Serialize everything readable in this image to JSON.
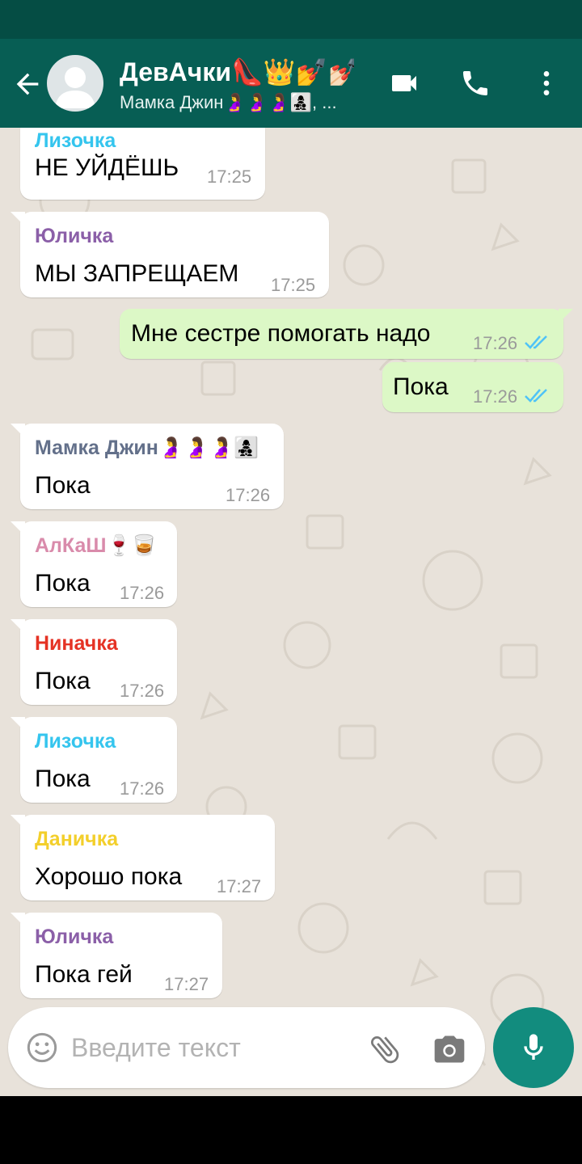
{
  "header": {
    "title": "ДевАчки👠👑💅💅🏻",
    "subtitle": "Мамка Джин🤰🤰🤰👩‍👧‍👦, ..."
  },
  "colors": {
    "header": "#075e54",
    "chat_bg": "#e8e2da",
    "outgoing": "#dcf8c6",
    "accent": "#128c7e",
    "read_ticks": "#4fc3f7"
  },
  "messages": [
    {
      "sender": "Лизочка",
      "sender_color": "#35c5ee",
      "text": "НЕ УЙДЁШЬ",
      "time": "17:25",
      "dir": "in"
    },
    {
      "sender": "Юличка",
      "sender_color": "#8b5fa8",
      "text": "МЫ ЗАПРЕЩАЕМ",
      "time": "17:25",
      "dir": "in"
    },
    {
      "text": "Мне сестре помогать надо",
      "time": "17:26",
      "dir": "out"
    },
    {
      "text": "Пока",
      "time": "17:26",
      "dir": "out"
    },
    {
      "sender": "Мамка Джин🤰🤰🤰👩‍👧‍👦",
      "sender_color": "#63708a",
      "text": "Пока",
      "time": "17:26",
      "dir": "in"
    },
    {
      "sender": "АлКаШ🍷🥃",
      "sender_color": "#d98bab",
      "text": "Пока",
      "time": "17:26",
      "dir": "in"
    },
    {
      "sender": "Ниначка",
      "sender_color": "#e53224",
      "text": "Пока",
      "time": "17:26",
      "dir": "in"
    },
    {
      "sender": "Лизочка",
      "sender_color": "#35c5ee",
      "text": "Пока",
      "time": "17:26",
      "dir": "in"
    },
    {
      "sender": "Даничка",
      "sender_color": "#f3cf2b",
      "text": "Хорошо пока",
      "time": "17:27",
      "dir": "in"
    },
    {
      "sender": "Юличка",
      "sender_color": "#8b5fa8",
      "text": "Пока гей",
      "time": "17:27",
      "dir": "in"
    }
  ],
  "input": {
    "placeholder": "Введите текст"
  },
  "icons": {
    "back": "arrow-left",
    "video": "video-camera",
    "call": "phone",
    "menu": "more-vert",
    "emoji": "smiley",
    "attach": "paperclip",
    "camera": "camera",
    "mic": "microphone"
  }
}
